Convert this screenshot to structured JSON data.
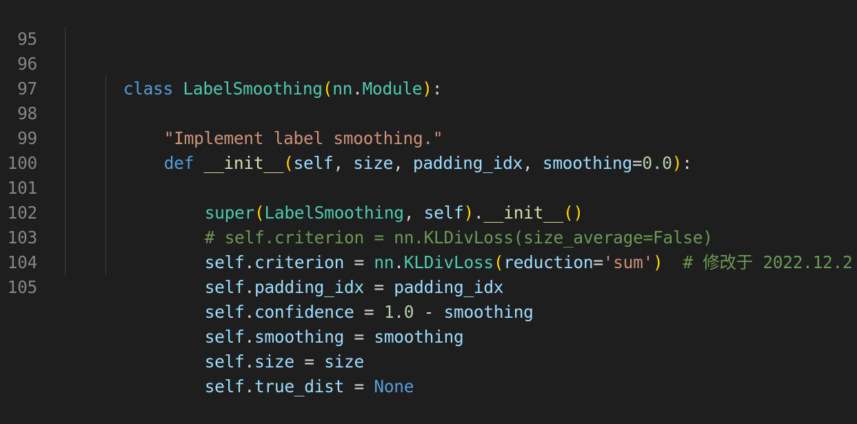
{
  "editor": {
    "lines": [
      {
        "num": "95",
        "tokens": [
          {
            "t": "class",
            "c": "kw"
          },
          {
            "t": " ",
            "c": "op"
          },
          {
            "t": "LabelSmoothing",
            "c": "cls"
          },
          {
            "t": "(",
            "c": "b1"
          },
          {
            "t": "nn",
            "c": "cls"
          },
          {
            "t": ".",
            "c": "op"
          },
          {
            "t": "Module",
            "c": "cls"
          },
          {
            "t": ")",
            "c": "b1"
          },
          {
            "t": ":",
            "c": "op"
          }
        ]
      },
      {
        "num": "96",
        "tokens": [
          {
            "t": "\"Implement label smoothing.\"",
            "c": "str"
          }
        ]
      },
      {
        "num": "97",
        "tokens": [
          {
            "t": "def",
            "c": "kw"
          },
          {
            "t": " ",
            "c": "op"
          },
          {
            "t": "__init__",
            "c": "fn"
          },
          {
            "t": "(",
            "c": "b1"
          },
          {
            "t": "self",
            "c": "var"
          },
          {
            "t": ", ",
            "c": "op"
          },
          {
            "t": "size",
            "c": "var"
          },
          {
            "t": ", ",
            "c": "op"
          },
          {
            "t": "padding_idx",
            "c": "var"
          },
          {
            "t": ", ",
            "c": "op"
          },
          {
            "t": "smoothing",
            "c": "var"
          },
          {
            "t": "=",
            "c": "op"
          },
          {
            "t": "0.0",
            "c": "num"
          },
          {
            "t": ")",
            "c": "b1"
          },
          {
            "t": ":",
            "c": "op"
          }
        ]
      },
      {
        "num": "98",
        "tokens": [
          {
            "t": "super",
            "c": "cls"
          },
          {
            "t": "(",
            "c": "b1"
          },
          {
            "t": "LabelSmoothing",
            "c": "cls"
          },
          {
            "t": ", ",
            "c": "op"
          },
          {
            "t": "self",
            "c": "var"
          },
          {
            "t": ")",
            "c": "b1"
          },
          {
            "t": ".",
            "c": "op"
          },
          {
            "t": "__init__",
            "c": "fn"
          },
          {
            "t": "()",
            "c": "b1"
          }
        ]
      },
      {
        "num": "99",
        "tokens": [
          {
            "t": "# self.criterion = nn.KLDivLoss(size_average=False)",
            "c": "com"
          }
        ]
      },
      {
        "num": "100",
        "tokens": [
          {
            "t": "self",
            "c": "var"
          },
          {
            "t": ".",
            "c": "op"
          },
          {
            "t": "criterion",
            "c": "var"
          },
          {
            "t": " = ",
            "c": "op"
          },
          {
            "t": "nn",
            "c": "cls"
          },
          {
            "t": ".",
            "c": "op"
          },
          {
            "t": "KLDivLoss",
            "c": "cls"
          },
          {
            "t": "(",
            "c": "b1"
          },
          {
            "t": "reduction",
            "c": "var"
          },
          {
            "t": "=",
            "c": "op"
          },
          {
            "t": "'sum'",
            "c": "str"
          },
          {
            "t": ")",
            "c": "b1"
          },
          {
            "t": "  ",
            "c": "op"
          },
          {
            "t": "# 修改于 2022.12.2",
            "c": "com"
          }
        ]
      },
      {
        "num": "101",
        "tokens": [
          {
            "t": "self",
            "c": "var"
          },
          {
            "t": ".",
            "c": "op"
          },
          {
            "t": "padding_idx",
            "c": "var"
          },
          {
            "t": " = ",
            "c": "op"
          },
          {
            "t": "padding_idx",
            "c": "var"
          }
        ]
      },
      {
        "num": "102",
        "tokens": [
          {
            "t": "self",
            "c": "var"
          },
          {
            "t": ".",
            "c": "op"
          },
          {
            "t": "confidence",
            "c": "var"
          },
          {
            "t": " = ",
            "c": "op"
          },
          {
            "t": "1.0",
            "c": "num"
          },
          {
            "t": " - ",
            "c": "op"
          },
          {
            "t": "smoothing",
            "c": "var"
          }
        ]
      },
      {
        "num": "103",
        "tokens": [
          {
            "t": "self",
            "c": "var"
          },
          {
            "t": ".",
            "c": "op"
          },
          {
            "t": "smoothing",
            "c": "var"
          },
          {
            "t": " = ",
            "c": "op"
          },
          {
            "t": "smoothing",
            "c": "var"
          }
        ]
      },
      {
        "num": "104",
        "tokens": [
          {
            "t": "self",
            "c": "var"
          },
          {
            "t": ".",
            "c": "op"
          },
          {
            "t": "size",
            "c": "var"
          },
          {
            "t": " = ",
            "c": "op"
          },
          {
            "t": "size",
            "c": "var"
          }
        ]
      },
      {
        "num": "105",
        "tokens": [
          {
            "t": "self",
            "c": "var"
          },
          {
            "t": ".",
            "c": "op"
          },
          {
            "t": "true_dist",
            "c": "var"
          },
          {
            "t": " = ",
            "c": "op"
          },
          {
            "t": "None",
            "c": "kw"
          }
        ]
      }
    ]
  }
}
